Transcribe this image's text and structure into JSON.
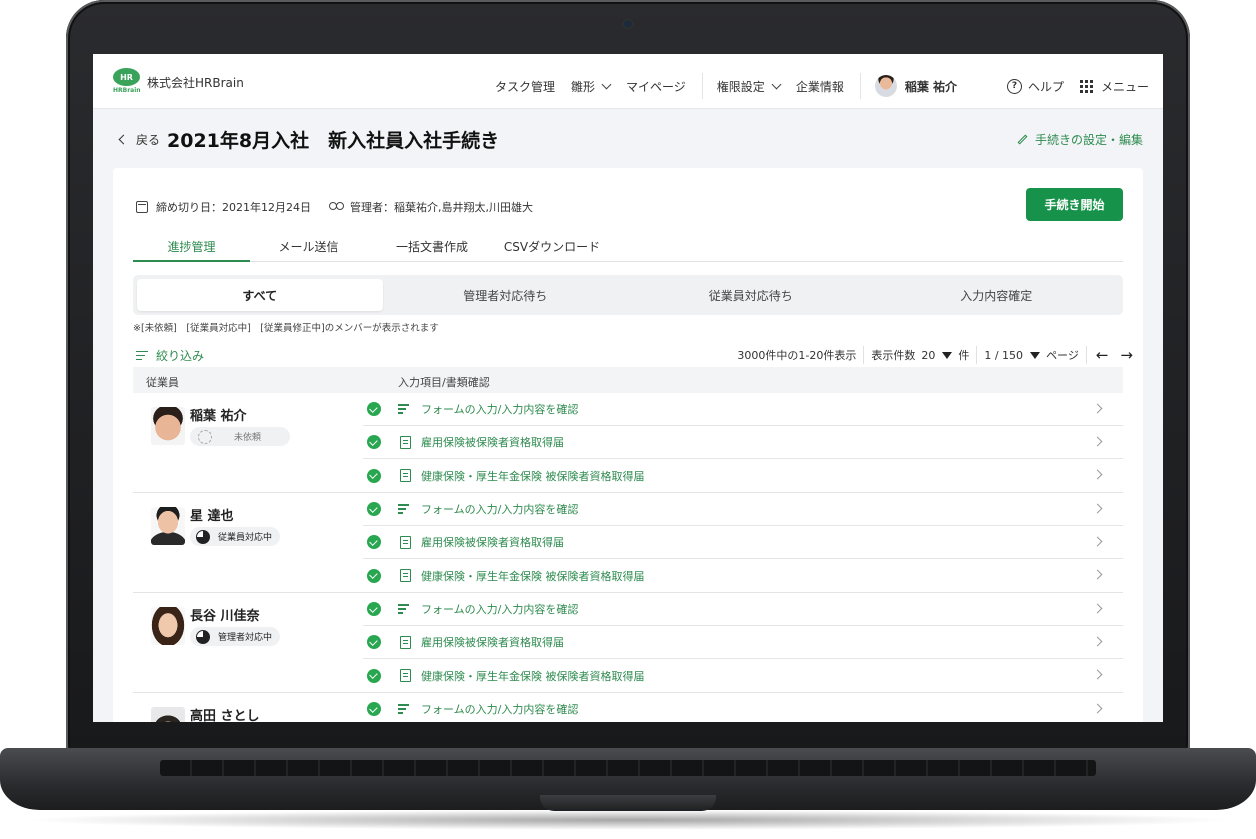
{
  "topnav": {
    "logo_text": "HR",
    "logo_sub": "HRBrain",
    "company": "株式会社HRBrain",
    "items": [
      "タスク管理",
      "雛形",
      "マイページ",
      "権限設定",
      "企業情報"
    ],
    "user_name": "稲葉 祐介",
    "help": "ヘルプ",
    "menu": "メニュー"
  },
  "header": {
    "back": "戻る",
    "title": "2021年8月入社　新入社員入社手続き",
    "settings": "手続きの設定・編集"
  },
  "meta": {
    "deadline": "締め切り日：2021年12月24日",
    "managers": "管理者：稲葉祐介,島井翔太,川田雄大",
    "start_button": "手続き開始"
  },
  "tabs": [
    "進捗管理",
    "メール送信",
    "一括文書作成",
    "CSVダウンロード"
  ],
  "segments": [
    "すべて",
    "管理者対応待ち",
    "従業員対応待ち",
    "入力内容確定"
  ],
  "note": "※[未依頼]　[従業員対応中]　[従業員修正中]のメンバーが表示されます",
  "filter": "絞り込み",
  "pager": {
    "summary": "3000件中の1-20件表示",
    "per_page_label": "表示件数",
    "per_page": "20",
    "per_page_unit": "件",
    "page": "1 / 150",
    "page_unit": "ページ",
    "prev": "←",
    "next": "→"
  },
  "table": {
    "col_employee": "従業員",
    "col_items": "入力項目/書類確認",
    "task_labels": [
      "フォームの入力/入力内容を確認",
      "雇用保険被保険者資格取得届",
      "健康保険・厚生年金保険 被保険者資格取得届"
    ],
    "employees": [
      {
        "name": "稲葉 祐介",
        "status": "未依頼"
      },
      {
        "name": "星 達也",
        "status": "従業員対応中"
      },
      {
        "name": "長谷 川佳奈",
        "status": "管理者対応中"
      },
      {
        "name": "高田 さとし",
        "status": ""
      }
    ]
  },
  "colors": {
    "accent": "#17924a",
    "link": "#2e8b4f",
    "check": "#28a650"
  }
}
